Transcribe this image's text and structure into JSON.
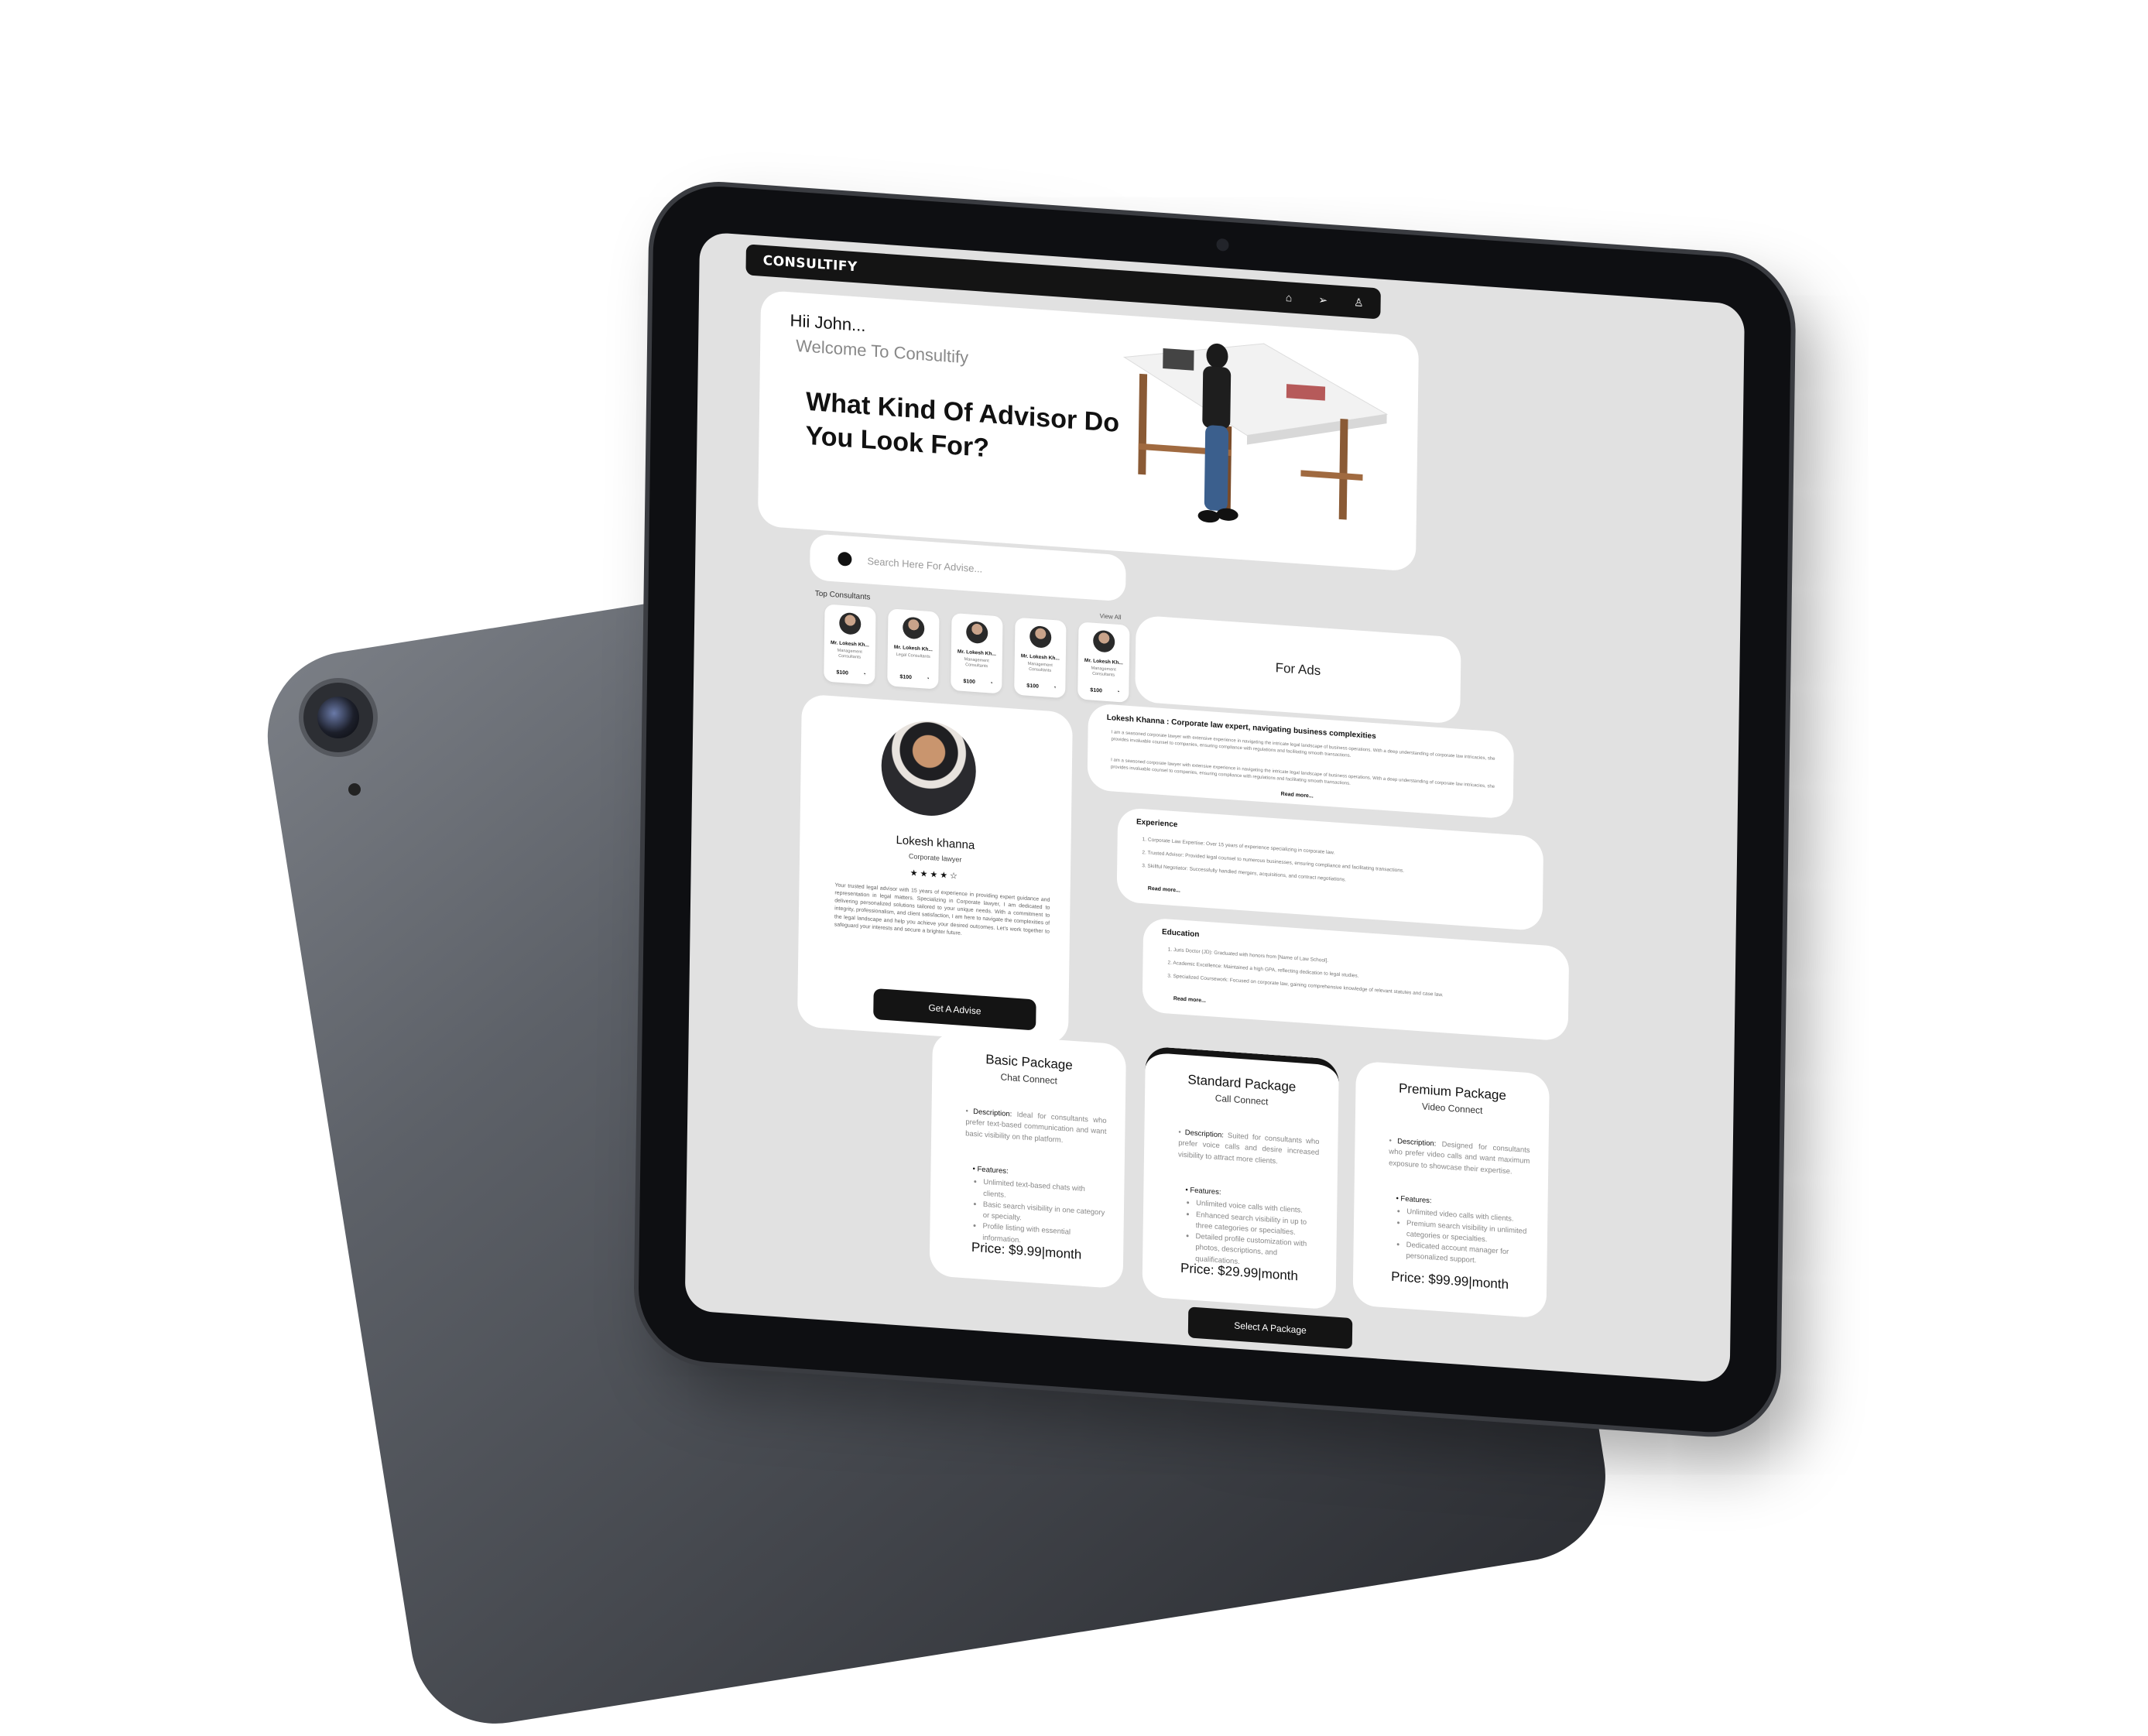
{
  "app": {
    "brand": "CONSULTIFY"
  },
  "nav": {
    "icons": [
      "home-icon",
      "send-icon",
      "user-icon"
    ]
  },
  "hero": {
    "greeting": "Hii John...",
    "welcome": "Welcome To Consultify",
    "headline": "What Kind Of Advisor Do You Look For?"
  },
  "search": {
    "placeholder": "Search Here For Advise..."
  },
  "top_consultants": {
    "label": "Top Consultants",
    "view_all": "View All",
    "items": [
      {
        "name": "Mr. Lokesh Kh...",
        "role": "Management Consultants",
        "price": "$100"
      },
      {
        "name": "Mr. Lokesh Kh...",
        "role": "Legal Consultants",
        "price": "$100"
      },
      {
        "name": "Mr. Lokesh Kh...",
        "role": "Management Consultants",
        "price": "$100"
      },
      {
        "name": "Mr. Lokesh Kh...",
        "role": "Management Consultants",
        "price": "$100"
      },
      {
        "name": "Mr. Lokesh Kh...",
        "role": "Management Consultants",
        "price": "$100"
      }
    ]
  },
  "ads": {
    "label": "For Ads"
  },
  "profile": {
    "name": "Lokesh khanna",
    "title": "Corporate lawyer",
    "rating": "★★★★☆",
    "bio": "Your trusted legal advisor with 15 years of experience in providing expert guidance and representation in legal matters. Specializing in Corporate lawyer, I am dedicated to delivering personalized solutions tailored to your unique needs. With a commitment to integrity, professionalism, and client satisfaction, I am here to navigate the complexities of the legal landscape and help you achieve your desired outcomes. Let's work together to safeguard your interests and secure a brighter future.",
    "cta": "Get A Advise"
  },
  "about": {
    "heading": "Lokesh Khanna : Corporate law expert, navigating business complexities",
    "para1": "I am a seasoned corporate lawyer with extensive experience in navigating the intricate legal landscape of business operations. With a deep understanding of corporate law intricacies, she provides invaluable counsel to companies, ensuring compliance with regulations and facilitating smooth transactions.",
    "para2": "I am a seasoned corporate lawyer with extensive experience in navigating the intricate legal landscape of business operations. With a deep understanding of corporate law intricacies, she provides invaluable counsel to companies, ensuring compliance with regulations and facilitating smooth transactions.",
    "read_more": "Read more..."
  },
  "experience": {
    "heading": "Experience",
    "items": [
      "1. Corporate Law Expertise: Over 15 years of experience specializing in corporate law.",
      "2. Trusted Advisor: Provided legal counsel to numerous businesses, ensuring compliance and facilitating transactions.",
      "3. Skillful Negotiator: Successfully handled mergers, acquisitions, and contract negotiations."
    ],
    "read_more": "Read more..."
  },
  "education": {
    "heading": "Education",
    "items": [
      "1. Juris Doctor (JD): Graduated with honors from [Name of Law School].",
      "2. Academic Excellence: Maintained a high GPA, reflecting dedication to legal studies.",
      "3. Specialized Coursework: Focused on corporate law, gaining comprehensive knowledge of relevant statutes and case law."
    ],
    "read_more": "Read more..."
  },
  "packages": [
    {
      "title": "Basic Package",
      "subtitle": "Chat Connect",
      "desc_label": "Description:",
      "desc": "Ideal for consultants who prefer text-based communication and want basic visibility on the platform.",
      "features_label": "Features:",
      "features": [
        "Unlimited text-based chats with clients.",
        "Basic search visibility in one category or specialty.",
        "Profile listing with essential information."
      ],
      "price": "Price: $9.99|month"
    },
    {
      "title": "Standard Package",
      "subtitle": "Call Connect",
      "desc_label": "Description:",
      "desc": "Suited for consultants who prefer voice calls and desire increased visibility to attract more clients.",
      "features_label": "Features:",
      "features": [
        "Unlimited voice calls with clients.",
        "Enhanced search visibility in up to three categories or specialties.",
        "Detailed profile customization with photos, descriptions, and qualifications."
      ],
      "price": "Price: $29.99|month"
    },
    {
      "title": "Premium Package",
      "subtitle": "Video Connect",
      "desc_label": "Description:",
      "desc": "Designed for consultants who prefer video calls and want maximum exposure to showcase their expertise.",
      "features_label": "Features:",
      "features": [
        "Unlimited video calls with clients.",
        "Premium search visibility in unlimited categories or specialties.",
        "Dedicated account manager for personalized support."
      ],
      "price": "Price: $99.99|month"
    }
  ],
  "footer": {
    "select_package": "Select A Package"
  }
}
